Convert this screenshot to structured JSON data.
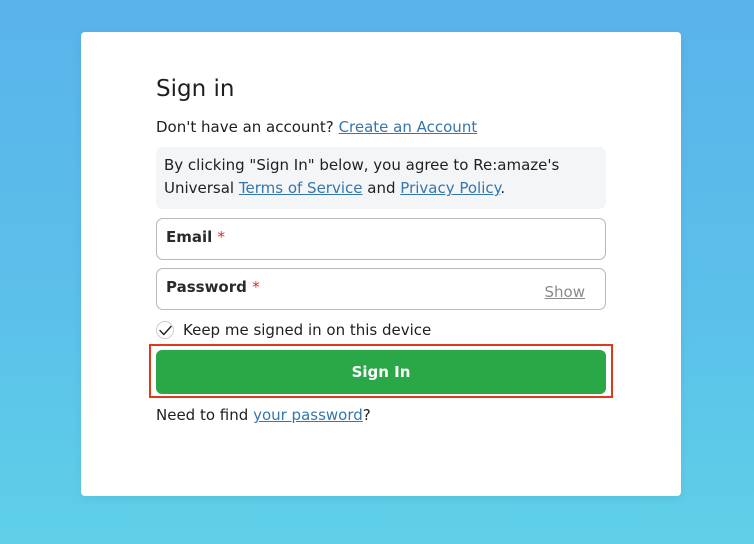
{
  "signin": {
    "title": "Sign in",
    "no_account_text": "Don't have an account?",
    "create_account_link": "Create an Account",
    "terms": {
      "prefix": "By clicking \"Sign In\" below, you agree to Re:amaze's Universal",
      "terms_link": "Terms of Service",
      "and": "and",
      "privacy_link": "Privacy Policy",
      "suffix": "."
    },
    "email": {
      "label": "Email",
      "required_mark": "*",
      "value": ""
    },
    "password": {
      "label": "Password",
      "required_mark": "*",
      "value": "",
      "show_label": "Show"
    },
    "keep_signed_in": {
      "label": "Keep me signed in on this device",
      "checked": true
    },
    "submit_label": "Sign In",
    "forgot_prefix": "Need to find",
    "forgot_link": "your password",
    "forgot_suffix": "?"
  },
  "colors": {
    "background": "#5bb8ea",
    "button": "#2aa848",
    "link": "#3576ad",
    "required": "#d93025",
    "highlight": "#e03a1a"
  },
  "icons": {
    "checkbox": "checkmark-icon"
  }
}
